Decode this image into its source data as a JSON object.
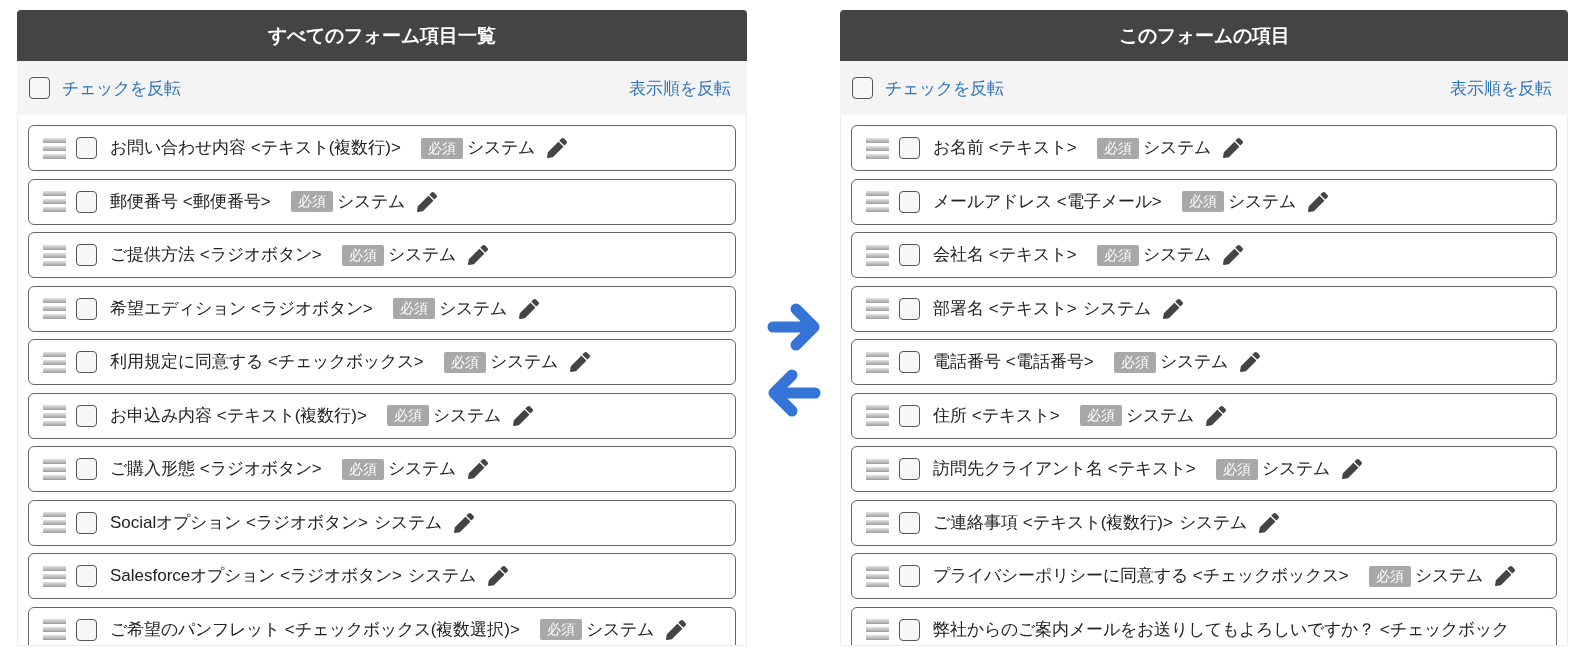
{
  "panels": [
    {
      "title": "すべてのフォーム項目一覧",
      "select_all": {
        "label": "チェックを反転",
        "checked": false
      },
      "reverse_order": "表示順を反転",
      "items": [
        {
          "label": "お問い合わせ内容 <テキスト(複数行)>",
          "badge": "必須",
          "owner": "システム",
          "checked": false,
          "edit_icon": true
        },
        {
          "label": "郵便番号 <郵便番号>",
          "badge": "必須",
          "owner": "システム",
          "checked": false,
          "edit_icon": true
        },
        {
          "label": "ご提供方法 <ラジオボタン>",
          "badge": "必須",
          "owner": "システム",
          "checked": false,
          "edit_icon": true
        },
        {
          "label": "希望エディション <ラジオボタン>",
          "badge": "必須",
          "owner": "システム",
          "checked": false,
          "edit_icon": true
        },
        {
          "label": "利用規定に同意する <チェックボックス>",
          "badge": "必須",
          "owner": "システム",
          "checked": false,
          "edit_icon": true
        },
        {
          "label": "お申込み内容 <テキスト(複数行)>",
          "badge": "必須",
          "owner": "システム",
          "checked": false,
          "edit_icon": true
        },
        {
          "label": "ご購入形態 <ラジオボタン>",
          "badge": "必須",
          "owner": "システム",
          "checked": false,
          "edit_icon": true
        },
        {
          "label": "Socialオプション <ラジオボタン>",
          "owner": "システム",
          "checked": false,
          "edit_icon": true
        },
        {
          "label": "Salesforceオプション <ラジオボタン>",
          "owner": "システム",
          "checked": false,
          "edit_icon": true
        },
        {
          "label": "ご希望のパンフレット <チェックボックス(複数選択)>",
          "badge": "必須",
          "owner": "システム",
          "checked": false,
          "edit_icon": true
        }
      ]
    },
    {
      "title": "このフォームの項目",
      "select_all": {
        "label": "チェックを反転",
        "checked": false
      },
      "reverse_order": "表示順を反転",
      "items": [
        {
          "label": "お名前 <テキスト>",
          "badge": "必須",
          "owner": "システム",
          "checked": false,
          "edit_icon": true
        },
        {
          "label": "メールアドレス <電子メール>",
          "badge": "必須",
          "owner": "システム",
          "checked": false,
          "edit_icon": true
        },
        {
          "label": "会社名 <テキスト>",
          "badge": "必須",
          "owner": "システム",
          "checked": false,
          "edit_icon": true
        },
        {
          "label": "部署名 <テキスト>",
          "owner": "システム",
          "checked": false,
          "edit_icon": true
        },
        {
          "label": "電話番号 <電話番号>",
          "badge": "必須",
          "owner": "システム",
          "checked": false,
          "edit_icon": true
        },
        {
          "label": "住所 <テキスト>",
          "badge": "必須",
          "owner": "システム",
          "checked": false,
          "edit_icon": true
        },
        {
          "label": "訪問先クライアント名 <テキスト>",
          "badge": "必須",
          "owner": "システム",
          "checked": false,
          "edit_icon": true
        },
        {
          "label": "ご連絡事項 <テキスト(複数行)>",
          "owner": "システム",
          "checked": false,
          "edit_icon": true
        },
        {
          "label": "プライバシーポリシーに同意する <チェックボックス>",
          "badge": "必須",
          "owner": "システム",
          "checked": false,
          "edit_icon": true
        },
        {
          "label": "弊社からのご案内メールをお送りしてもよろしいですか？ <チェックボック",
          "checked": false,
          "edit_icon": false
        }
      ]
    }
  ]
}
